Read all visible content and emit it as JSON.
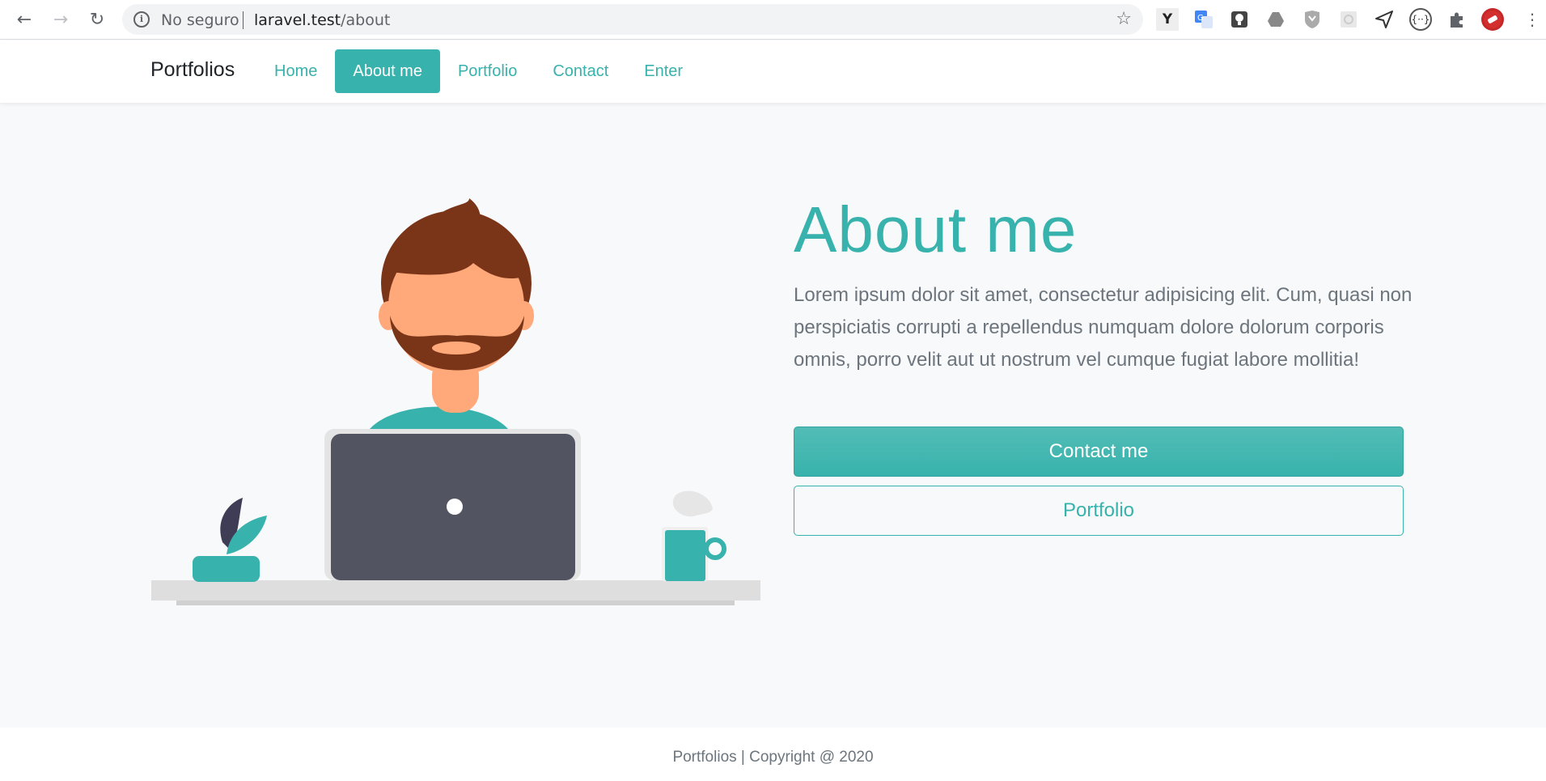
{
  "browser": {
    "security_label": "No seguro",
    "url_host": "laravel.test",
    "url_path": "/about",
    "extensions": [
      "y-extension-icon",
      "google-translate-icon",
      "lightbulb-extension-icon",
      "google-drive-icon",
      "shield-extension-icon",
      "grid-extension-icon",
      "send-extension-icon",
      "braces-extension-icon",
      "puzzle-icon",
      "profile-avatar"
    ]
  },
  "navbar": {
    "brand": "Portfolios",
    "links": [
      {
        "label": "Home",
        "active": false
      },
      {
        "label": "About me",
        "active": true
      },
      {
        "label": "Portfolio",
        "active": false
      },
      {
        "label": "Contact",
        "active": false
      },
      {
        "label": "Enter",
        "active": false
      }
    ]
  },
  "hero": {
    "title": "About me",
    "description": "Lorem ipsum dolor sit amet, consectetur adipisicing elit. Cum, quasi non perspiciatis corrupti a repellendus numquam dolore dolorum corporis omnis, porro velit aut ut nostrum vel cumque fugiat labore mollitia!",
    "primary_button": "Contact me",
    "secondary_button": "Portfolio"
  },
  "footer": {
    "copyright": "Portfolios | Copyright @ 2020"
  },
  "colors": {
    "accent": "#38b2ac",
    "background": "#f8f9fa",
    "text_muted": "#6c757d"
  }
}
